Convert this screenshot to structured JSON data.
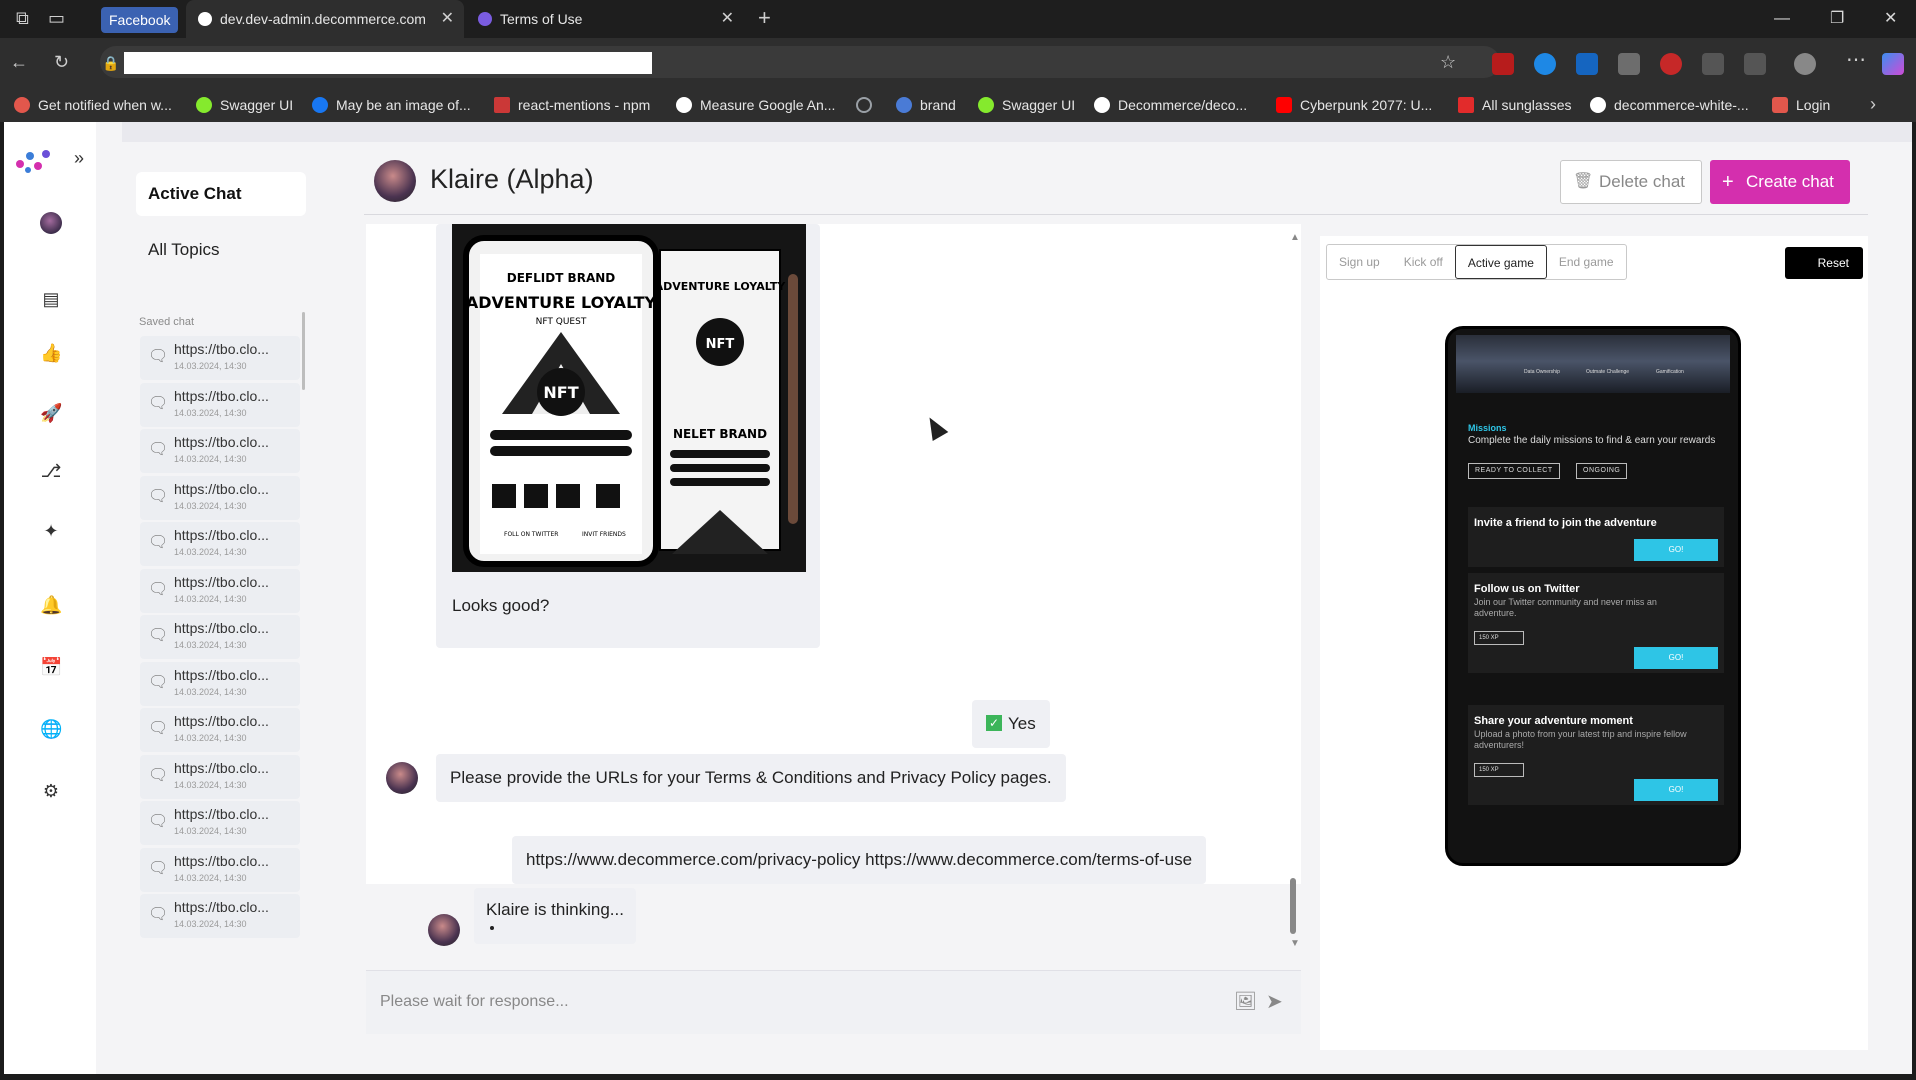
{
  "browser": {
    "tabs": [
      {
        "label": "Facebook"
      },
      {
        "label": "dev.dev-admin.decommerce.com"
      },
      {
        "label": "Terms of Use"
      }
    ],
    "bookmarks": [
      {
        "label": "Get notified when w...",
        "color": "#e2574c"
      },
      {
        "label": "Swagger UI",
        "color": "#85ea2d"
      },
      {
        "label": "May be an image of...",
        "color": "#1877f2"
      },
      {
        "label": "react-mentions - npm",
        "color": "#cb3837"
      },
      {
        "label": "Measure Google An...",
        "color": "#ffffff"
      },
      {
        "label": "",
        "color": "#9aa0a6"
      },
      {
        "label": "brand",
        "color": "#4a7bd6"
      },
      {
        "label": "Swagger UI",
        "color": "#85ea2d"
      },
      {
        "label": "Decommerce/deco...",
        "color": "#ffffff"
      },
      {
        "label": "Cyberpunk 2077: U...",
        "color": "#ff0000"
      },
      {
        "label": "All sunglasses",
        "color": "#e22b2b"
      },
      {
        "label": "decommerce-white-...",
        "color": "#ffffff"
      },
      {
        "label": "Login",
        "color": "#e2574c"
      }
    ]
  },
  "sidebar": {
    "active_chat": "Active Chat",
    "all_topics": "All Topics",
    "saved_label": "Saved chat",
    "saved_items": [
      {
        "url": "https://tbo.clo...",
        "date": "14.03.2024, 14:30"
      },
      {
        "url": "https://tbo.clo...",
        "date": "14.03.2024, 14:30"
      },
      {
        "url": "https://tbo.clo...",
        "date": "14.03.2024, 14:30"
      },
      {
        "url": "https://tbo.clo...",
        "date": "14.03.2024, 14:30"
      },
      {
        "url": "https://tbo.clo...",
        "date": "14.03.2024, 14:30"
      },
      {
        "url": "https://tbo.clo...",
        "date": "14.03.2024, 14:30"
      },
      {
        "url": "https://tbo.clo...",
        "date": "14.03.2024, 14:30"
      },
      {
        "url": "https://tbo.clo...",
        "date": "14.03.2024, 14:30"
      },
      {
        "url": "https://tbo.clo...",
        "date": "14.03.2024, 14:30"
      },
      {
        "url": "https://tbo.clo...",
        "date": "14.03.2024, 14:30"
      },
      {
        "url": "https://tbo.clo...",
        "date": "14.03.2024, 14:30"
      },
      {
        "url": "https://tbo.clo...",
        "date": "14.03.2024, 14:30"
      },
      {
        "url": "https://tbo.clo...",
        "date": "14.03.2024, 14:30"
      }
    ]
  },
  "header": {
    "title": "Klaire (Alpha)",
    "delete_label": "Delete chat",
    "create_label": "Create chat",
    "accent": "#d42fae"
  },
  "chat": {
    "nft_image": {
      "brand_top": "DEFLIDT BRAND",
      "headline": "ADVENTURE LOYALTY",
      "subline": "NFT QUEST",
      "badge": "NFT",
      "side_headline": "ADVENTURE LOYALTY",
      "side_brand": "NELET BRAND",
      "follow": "FOLL ON TWITTER",
      "invite": "INVIT FRIENDS"
    },
    "bot_image_caption": "Looks good?",
    "user_reply_1": "Yes",
    "bot_message_2": "Please provide the URLs for your Terms & Conditions and Privacy Policy pages.",
    "user_reply_2": "https://www.decommerce.com/privacy-policy https://www.decommerce.com/terms-of-use",
    "thinking": "Klaire is thinking..."
  },
  "composer": {
    "placeholder": "Please wait for response..."
  },
  "preview": {
    "stages": [
      "Sign up",
      "Kick off",
      "Active game",
      "End game"
    ],
    "active_stage": "Active game",
    "reset_label": "Reset",
    "phone": {
      "hero_labels": [
        "Data Ownership",
        "Outmate Challenge",
        "Gamification"
      ],
      "missions_title": "Missions",
      "missions_sub": "Complete the daily missions to find & earn your rewards",
      "filters": [
        "READY TO COLLECT",
        "ONGOING"
      ],
      "cards": [
        {
          "title": "Invite a friend to join the adventure",
          "desc": "",
          "xp": "",
          "go": "GO!"
        },
        {
          "title": "Follow us on Twitter",
          "desc": "Join our Twitter community and never miss an adventure.",
          "xp": "150 XP",
          "go": "GO!"
        },
        {
          "title": "Share your adventure moment",
          "desc": "Upload a photo from your latest trip and inspire fellow adventurers!",
          "xp": "150 XP",
          "go": "GO!"
        }
      ],
      "accent": "#2ec5e6"
    }
  }
}
